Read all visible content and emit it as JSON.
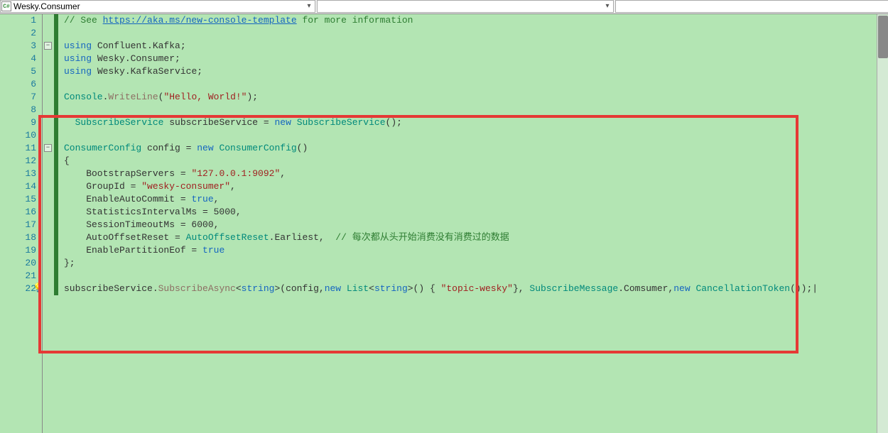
{
  "dropdowns": {
    "first": "Wesky.Consumer",
    "second": "",
    "third": ""
  },
  "lineNumbers": [
    "1",
    "2",
    "3",
    "4",
    "5",
    "6",
    "7",
    "8",
    "9",
    "10",
    "11",
    "12",
    "13",
    "14",
    "15",
    "16",
    "17",
    "18",
    "19",
    "20",
    "21",
    "22"
  ],
  "code": {
    "l1_comment_pre": "// See ",
    "l1_link": "https://aka.ms/new-console-template",
    "l1_comment_post": " for more information",
    "l3_using": "using",
    "l3_ns": " Confluent.Kafka;",
    "l4_using": "using",
    "l4_ns": " Wesky.Consumer;",
    "l5_using": "using",
    "l5_ns": " Wesky.KafkaService;",
    "l7_console": "Console",
    "l7_dot": ".",
    "l7_method": "WriteLine",
    "l7_paren_open": "(",
    "l7_string": "\"Hello, World!\"",
    "l7_close": ");",
    "l9_type": "SubscribeService",
    "l9_var": " subscribeService = ",
    "l9_new": "new",
    "l9_sp": " ",
    "l9_type2": "SubscribeService",
    "l9_close": "();",
    "l11_type": "ConsumerConfig",
    "l11_var": " config = ",
    "l11_new": "new",
    "l11_sp": " ",
    "l11_type2": "ConsumerConfig",
    "l11_close": "()",
    "l12_brace": "{",
    "l13_prop": "    BootstrapServers = ",
    "l13_val": "\"127.0.0.1:9092\"",
    "l13_comma": ",",
    "l14_prop": "    GroupId = ",
    "l14_val": "\"wesky-consumer\"",
    "l14_comma": ",",
    "l15_prop": "    EnableAutoCommit = ",
    "l15_val": "true",
    "l15_comma": ",",
    "l16_prop": "    StatisticsIntervalMs = 5000,",
    "l17_prop": "    SessionTimeoutMs = 6000,",
    "l18_prop": "    AutoOffsetReset = ",
    "l18_type": "AutoOffsetReset",
    "l18_dot": ".Earliest,  ",
    "l18_comment": "// 每次都从头开始消费没有消费过的数据",
    "l19_prop": "    EnablePartitionEof = ",
    "l19_val": "true",
    "l20_brace": "};",
    "l22_obj": "subscribeService.",
    "l22_method": "SubscribeAsync",
    "l22_lt": "<",
    "l22_str": "string",
    "l22_gt": ">(config,",
    "l22_new": "new",
    "l22_sp": " ",
    "l22_list": "List",
    "l22_lt2": "<",
    "l22_str2": "string",
    "l22_gt2": ">() { ",
    "l22_topic": "\"topic-wesky\"",
    "l22_close1": "}, ",
    "l22_sm": "SubscribeMessage",
    "l22_comsumer": ".Comsumer,",
    "l22_new2": "new",
    "l22_sp2": " ",
    "l22_ct": "CancellationToken",
    "l22_close2": "());"
  },
  "cursor": "|"
}
